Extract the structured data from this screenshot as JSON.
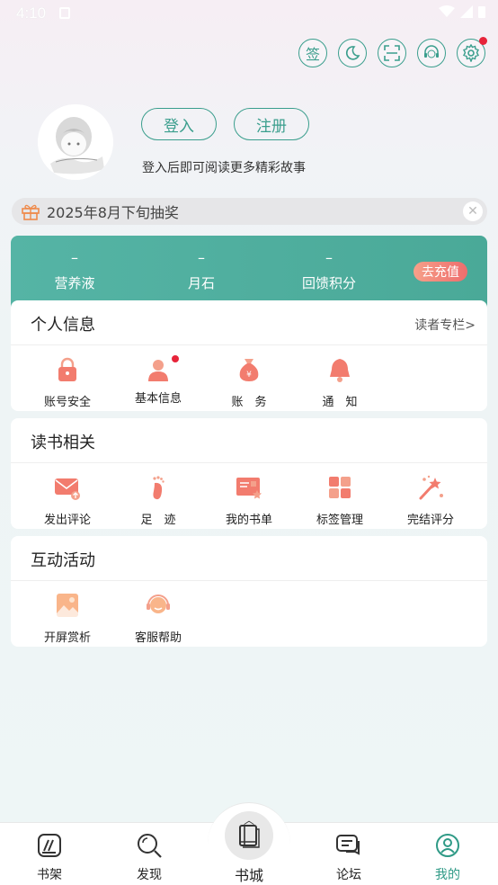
{
  "status_bar": {
    "time": "4:10"
  },
  "top_actions": {
    "checkin_label": "签"
  },
  "auth": {
    "login_label": "登入",
    "register_label": "注册",
    "tip": "登入后即可阅读更多精彩故事"
  },
  "banner": {
    "text": "2025年8月下旬抽奖"
  },
  "wallet": {
    "stats": [
      {
        "value": "–",
        "label": "营养液"
      },
      {
        "value": "–",
        "label": "月石"
      },
      {
        "value": "–",
        "label": "回馈积分"
      }
    ],
    "recharge_label": "去充值"
  },
  "personal": {
    "title": "个人信息",
    "more": "读者专栏>",
    "items": [
      {
        "label": "账号安全",
        "icon": "lock-icon"
      },
      {
        "label": "基本信息",
        "icon": "person-icon"
      },
      {
        "label": "账　务",
        "icon": "money-bag-icon"
      },
      {
        "label": "通　知",
        "icon": "bell-icon"
      }
    ]
  },
  "reading": {
    "title": "读书相关",
    "items": [
      {
        "label": "发出评论",
        "icon": "mail-icon"
      },
      {
        "label": "足　迹",
        "icon": "footprint-icon"
      },
      {
        "label": "我的书单",
        "icon": "booklist-icon"
      },
      {
        "label": "标签管理",
        "icon": "tags-icon"
      },
      {
        "label": "完结评分",
        "icon": "magic-wand-icon"
      }
    ]
  },
  "activity": {
    "title": "互动活动",
    "items": [
      {
        "label": "开屏赏析",
        "icon": "picture-icon"
      },
      {
        "label": "客服帮助",
        "icon": "headset-icon"
      }
    ]
  },
  "nav": {
    "shelf": "书架",
    "discover": "发现",
    "store": "书城",
    "forum": "论坛",
    "mine": "我的"
  },
  "colors": {
    "accent": "#3a9e8d",
    "wallet": "#4aa998",
    "alert": "#e7243a"
  }
}
